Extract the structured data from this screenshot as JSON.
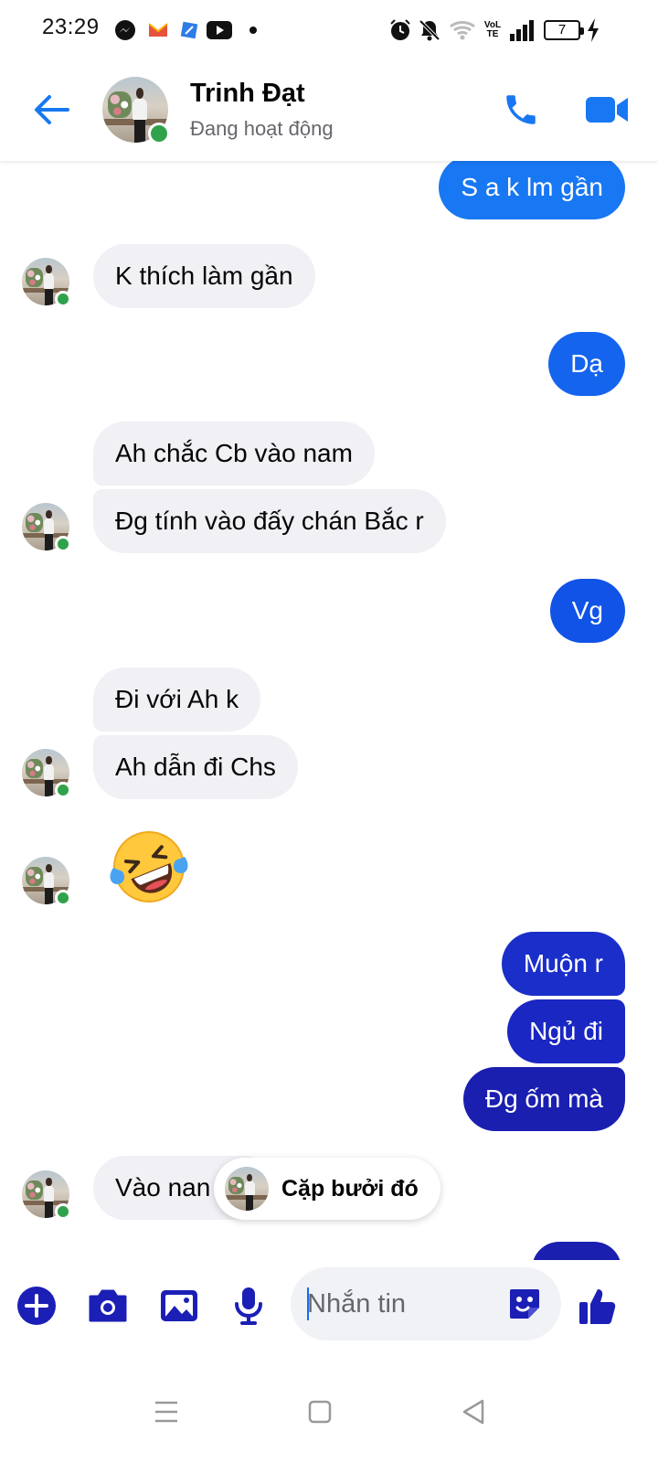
{
  "status_bar": {
    "time": "23:29",
    "battery": "7",
    "icons_left": [
      "messenger-icon",
      "mail-app-icon",
      "browser-app-icon",
      "youtube-icon",
      "dot-icon"
    ],
    "icons_right": [
      "alarm-icon",
      "mute-icon",
      "wifi-icon",
      "volte-icon",
      "signal-icon",
      "battery-icon",
      "charging-icon"
    ],
    "volte_label": "VoLTE"
  },
  "header": {
    "name": "Trinh Đạt",
    "status": "Đang hoạt động"
  },
  "colors": {
    "accent": "#1877f2",
    "outgoing_light": "#1877f2",
    "outgoing_mid": "#1053e6",
    "outgoing_dark": "#1a1fb0",
    "incoming_bg": "#f0f0f5",
    "online_dot": "#31a24c",
    "toolbar_icon": "#1b1fb5"
  },
  "messages": [
    {
      "dir": "out",
      "text": "S a k lm gần"
    },
    {
      "dir": "in",
      "text": "K thích làm gần"
    },
    {
      "dir": "out",
      "text": "Dạ"
    },
    {
      "dir": "in",
      "text": "Ah chắc Cb vào nam"
    },
    {
      "dir": "in",
      "text": "Đg tính vào đấy chán Bắc r"
    },
    {
      "dir": "out",
      "text": "Vg"
    },
    {
      "dir": "in",
      "text": "Đi với Ah k"
    },
    {
      "dir": "in",
      "text": "Ah dẫn đi Chs"
    },
    {
      "dir": "in",
      "emoji": "rolling-on-floor-laughing"
    },
    {
      "dir": "out",
      "text": "Muộn r"
    },
    {
      "dir": "out",
      "text": "Ngủ đi"
    },
    {
      "dir": "out",
      "text": "Đg ốm mà"
    },
    {
      "dir": "in",
      "text": "Vào nan"
    }
  ],
  "reply_chip": {
    "text": "Cặp bưởi đó"
  },
  "composer": {
    "placeholder": "Nhắn tin",
    "tools": [
      "add-icon",
      "camera-icon",
      "gallery-icon",
      "microphone-icon"
    ],
    "sticker": "sticker-icon",
    "send": "thumbs-up-icon"
  },
  "navbar": {
    "buttons": [
      "menu-icon",
      "home-icon",
      "back-icon"
    ]
  }
}
